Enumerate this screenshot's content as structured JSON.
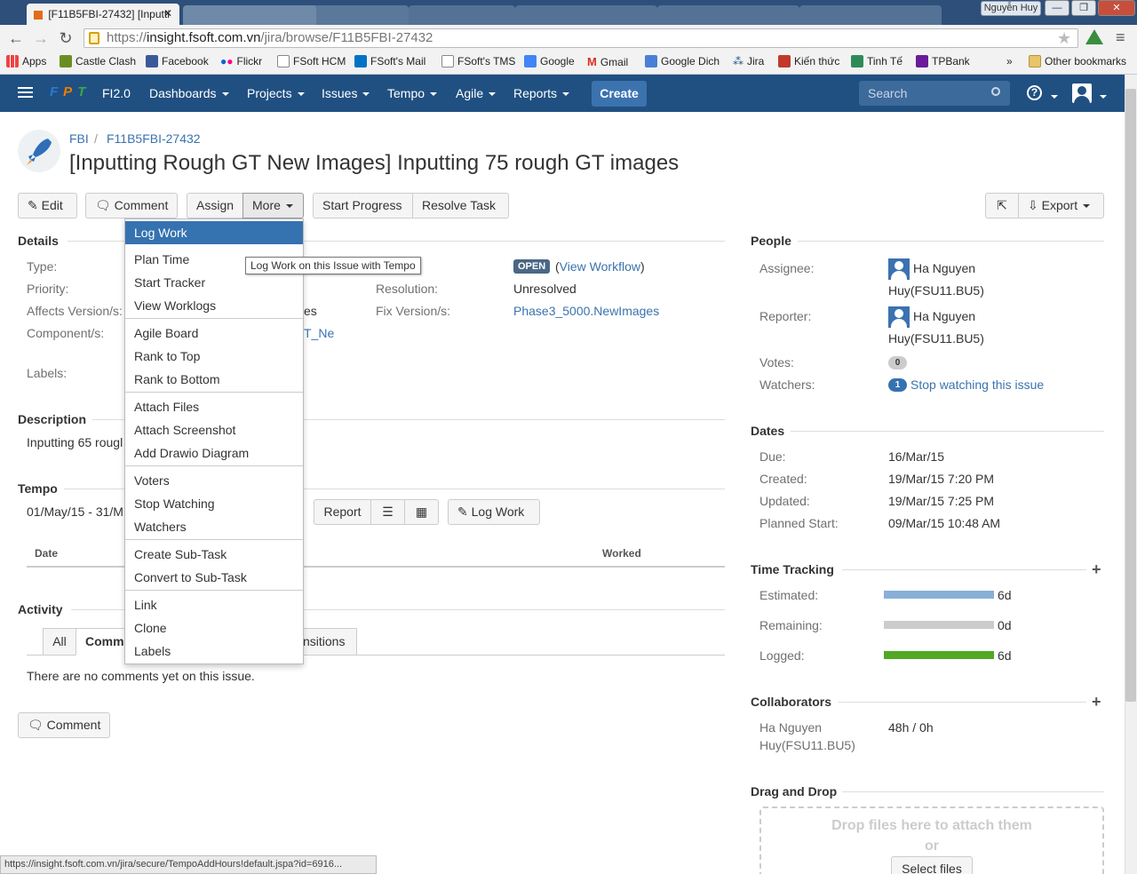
{
  "browser": {
    "tab_title": "[F11B5FBI-27432] [Inputti",
    "tab_close": "✕",
    "user_tag": "Nguyễn Huy",
    "url_scheme": "https://",
    "url_host": "insight.fsoft.com.vn",
    "url_path": "/jira/browse/F11B5FBI-27432",
    "bookmarks": [
      "Apps",
      "Castle Clash",
      "Facebook",
      "Flickr",
      "FSoft HCM",
      "FSoft's Mail",
      "FSoft's TMS",
      "Google",
      "Gmail",
      "Google Dich",
      "Jira",
      "Kiến thức",
      "Tinh Tế",
      "TPBank"
    ],
    "more_bookmarks": "»",
    "other_bookmarks": "Other bookmarks",
    "status_url": "https://insight.fsoft.com.vn/jira/secure/TempoAddHours!default.jspa?id=6916..."
  },
  "header": {
    "logo_text": "FPT",
    "project": "FI2.0",
    "nav": [
      "Dashboards",
      "Projects",
      "Issues",
      "Tempo",
      "Agile",
      "Reports"
    ],
    "create_label": "Create",
    "search_placeholder": "Search",
    "help_icon": "?"
  },
  "issue": {
    "breadcrumb_project": "FBI",
    "breadcrumb_sep": "/",
    "breadcrumb_key": "F11B5FBI-27432",
    "summary": "[Inputting Rough GT New Images] Inputting 75 rough GT images"
  },
  "actions": {
    "edit": "Edit",
    "comment": "Comment",
    "assign": "Assign",
    "more": "More",
    "start_progress": "Start Progress",
    "resolve": "Resolve Task",
    "export": "Export"
  },
  "details": {
    "title": "Details",
    "type_label": "Type:",
    "priority_label": "Priority:",
    "affects_label": "Affects Version/s:",
    "affects_partial": "es",
    "components_label": "Component/s:",
    "components_partial": "T_Ne",
    "labels_label": "Labels:",
    "status_badge": "OPEN",
    "view_workflow": "View Workflow",
    "paren_open": "(",
    "paren_close": ")",
    "resolution_label": "Resolution:",
    "resolution_value": "Unresolved",
    "fix_label": "Fix Version/s:",
    "fix_value": "Phase3_5000.NewImages"
  },
  "description": {
    "title": "Description",
    "text": "Inputting 65 rougl"
  },
  "tempo": {
    "title": "Tempo",
    "period": "01/May/15 - 31/M",
    "report": "Report",
    "log_work": "Log Work",
    "col_date": "Date",
    "col_worked": "Worked"
  },
  "activity": {
    "title": "Activity",
    "tab_all": "All",
    "tab_comments": "Comm",
    "tab_transitions": "nsitions",
    "no_comments": "There are no comments yet on this issue.",
    "comment_button": "Comment"
  },
  "more_menu": {
    "groups": [
      [
        "Log Work",
        "Plan Time",
        "Start Tracker",
        "View Worklogs"
      ],
      [
        "Agile Board",
        "Rank to Top",
        "Rank to Bottom"
      ],
      [
        "Attach Files",
        "Attach Screenshot",
        "Add Drawio Diagram"
      ],
      [
        "Voters",
        "Stop Watching",
        "Watchers"
      ],
      [
        "Create Sub-Task",
        "Convert to Sub-Task"
      ],
      [
        "Link",
        "Clone",
        "Labels"
      ]
    ],
    "tooltip": "Log Work on this Issue with Tempo"
  },
  "people": {
    "title": "People",
    "assignee_label": "Assignee:",
    "assignee_line1": "Ha Nguyen",
    "assignee_line2": "Huy(FSU11.BU5)",
    "reporter_label": "Reporter:",
    "reporter_line1": "Ha Nguyen",
    "reporter_line2": "Huy(FSU11.BU5)",
    "votes_label": "Votes:",
    "votes_count": "0",
    "watchers_label": "Watchers:",
    "watchers_count": "1",
    "stop_watching": "Stop watching this issue"
  },
  "dates": {
    "title": "Dates",
    "due_label": "Due:",
    "due": "16/Mar/15",
    "created_label": "Created:",
    "created": "19/Mar/15 7:20 PM",
    "updated_label": "Updated:",
    "updated": "19/Mar/15 7:25 PM",
    "planned_label": "Planned Start:",
    "planned": "09/Mar/15 10:48 AM"
  },
  "time_tracking": {
    "title": "Time Tracking",
    "estimated_label": "Estimated:",
    "estimated": "6d",
    "remaining_label": "Remaining:",
    "remaining": "0d",
    "logged_label": "Logged:",
    "logged": "6d",
    "colors": {
      "estimated": "#89afd7",
      "remaining": "#cccccc",
      "logged": "#51a825"
    }
  },
  "collaborators": {
    "title": "Collaborators",
    "name_line1": "Ha Nguyen",
    "name_line2": "Huy(FSU11.BU5)",
    "hours": "48h / 0h"
  },
  "drag_drop": {
    "title": "Drag and Drop",
    "drop_text": "Drop files here to attach them",
    "or": "or",
    "select_files": "Select files"
  }
}
